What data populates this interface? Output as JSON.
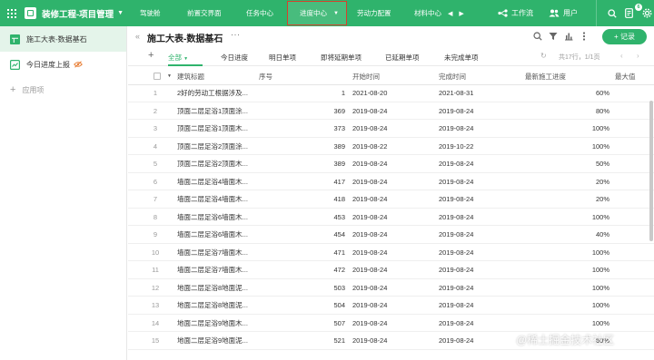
{
  "header": {
    "app_title": "装修工程-项目管理",
    "nav": [
      {
        "label": "驾驶舱"
      },
      {
        "label": "前置交界面"
      },
      {
        "label": "任务中心"
      },
      {
        "label": "进度中心"
      },
      {
        "label": "劳动力配置"
      },
      {
        "label": "材料中心"
      }
    ],
    "workflow_label": "工作流",
    "user_label": "用户",
    "notification_count": "6",
    "brand_color": "#2fb36c",
    "active_nav_border": "#d7402c"
  },
  "sidebar": {
    "items": [
      {
        "label": "施工大表-数据基石",
        "icon": "table-icon"
      },
      {
        "label": "今日进度上报",
        "icon": "form-icon",
        "hidden_icon": "eye-off-icon"
      }
    ],
    "add_app_label": "应用项"
  },
  "view": {
    "title": "施工大表-数据基石",
    "more": "···",
    "add_record_label": "+ 记录",
    "tabs": [
      "全部",
      "今日进度",
      "明日单项",
      "即将延期单项",
      "已延期单项",
      "未完成单项"
    ],
    "pager_text": "共17行，1/1页"
  },
  "table": {
    "columns": [
      "建筑标题",
      "序号",
      "开始时间",
      "完成时间",
      "最新施工进度",
      "最大值"
    ],
    "rows": [
      {
        "idx": "1",
        "title": "2好的劳动工根据涉及...",
        "seq": "1",
        "start": "2021-08-20",
        "end": "2021-08-31",
        "progress": "60%"
      },
      {
        "idx": "2",
        "title": "顶面二层足浴1顶面涂...",
        "seq": "369",
        "start": "2019-08-24",
        "end": "2019-08-24",
        "progress": "80%"
      },
      {
        "idx": "3",
        "title": "顶面二层足浴1顶面木...",
        "seq": "373",
        "start": "2019-08-24",
        "end": "2019-08-24",
        "progress": "100%"
      },
      {
        "idx": "4",
        "title": "顶面二层足浴2顶面涂...",
        "seq": "389",
        "start": "2019-08-22",
        "end": "2019-10-22",
        "progress": "100%"
      },
      {
        "idx": "5",
        "title": "顶面二层足浴2顶面木...",
        "seq": "389",
        "start": "2019-08-24",
        "end": "2019-08-24",
        "progress": "50%"
      },
      {
        "idx": "6",
        "title": "墙面二层足浴4墙面木...",
        "seq": "417",
        "start": "2019-08-24",
        "end": "2019-08-24",
        "progress": "20%"
      },
      {
        "idx": "7",
        "title": "墙面二层足浴4墙面木...",
        "seq": "418",
        "start": "2019-08-24",
        "end": "2019-08-24",
        "progress": "20%"
      },
      {
        "idx": "8",
        "title": "墙面二层足浴6墙面木...",
        "seq": "453",
        "start": "2019-08-24",
        "end": "2019-08-24",
        "progress": "100%"
      },
      {
        "idx": "9",
        "title": "墙面二层足浴6墙面木...",
        "seq": "454",
        "start": "2019-08-24",
        "end": "2019-08-24",
        "progress": "40%"
      },
      {
        "idx": "10",
        "title": "墙面二层足浴7墙面木...",
        "seq": "471",
        "start": "2019-08-24",
        "end": "2019-08-24",
        "progress": "100%"
      },
      {
        "idx": "11",
        "title": "墙面二层足浴7墙面木...",
        "seq": "472",
        "start": "2019-08-24",
        "end": "2019-08-24",
        "progress": "100%"
      },
      {
        "idx": "12",
        "title": "地面二层足浴8地面泥...",
        "seq": "503",
        "start": "2019-08-24",
        "end": "2019-08-24",
        "progress": "100%"
      },
      {
        "idx": "13",
        "title": "地面二层足浴8地面泥...",
        "seq": "504",
        "start": "2019-08-24",
        "end": "2019-08-24",
        "progress": "100%"
      },
      {
        "idx": "14",
        "title": "地面二层足浴9地面木...",
        "seq": "507",
        "start": "2019-08-24",
        "end": "2019-08-24",
        "progress": "100%"
      },
      {
        "idx": "15",
        "title": "地面二层足浴9地面泥...",
        "seq": "521",
        "start": "2019-08-24",
        "end": "2019-08-24",
        "progress": "60%"
      }
    ]
  },
  "watermark": "@稀土掘金技术社区"
}
